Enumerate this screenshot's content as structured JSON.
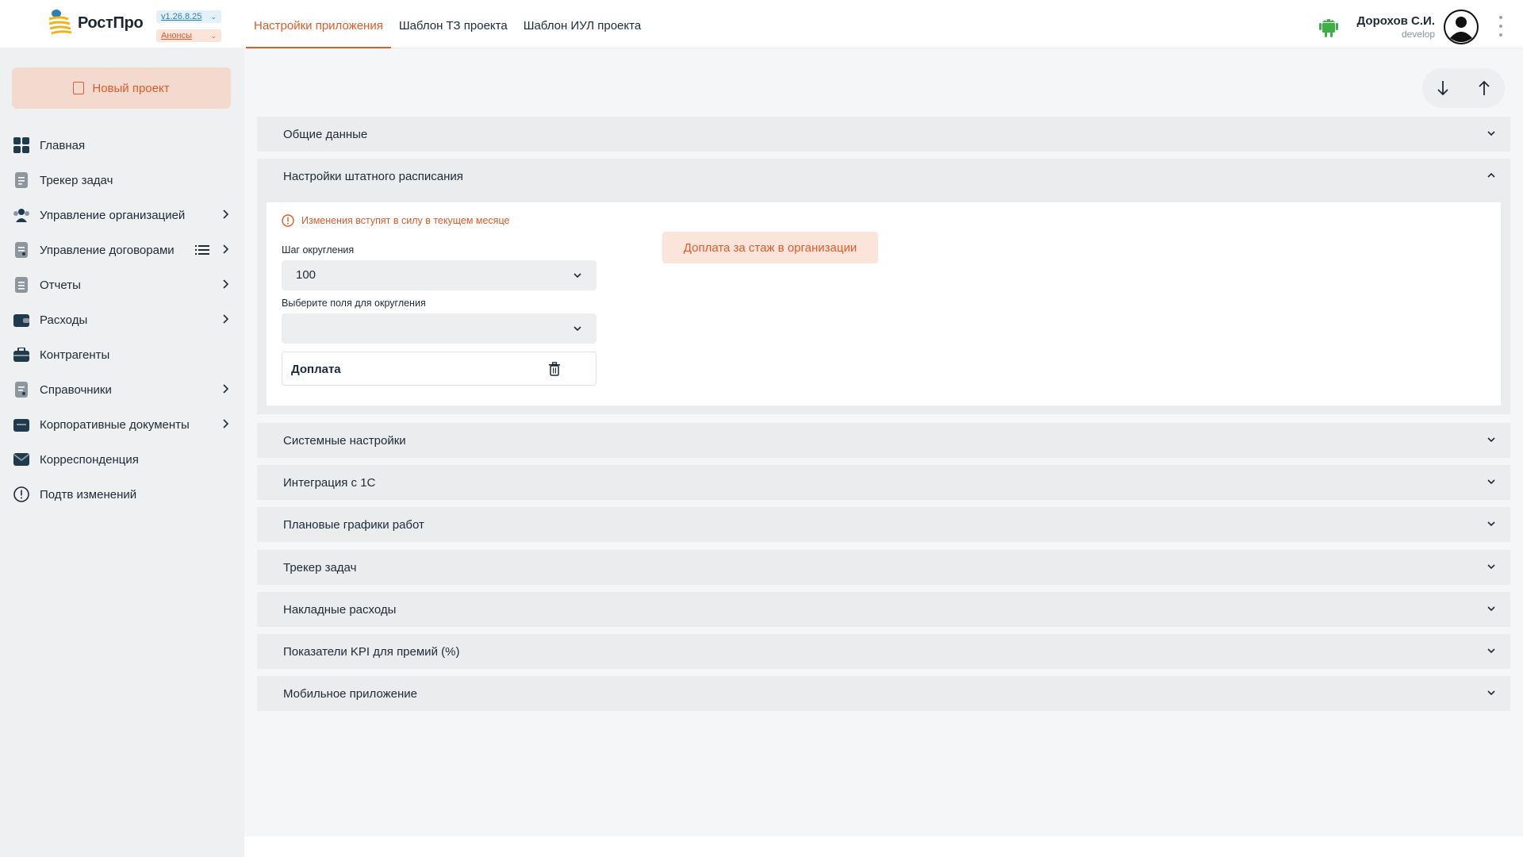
{
  "header": {
    "logo_text": "РостПро",
    "version": "v1.26.8.25",
    "announcements": "Анонсы",
    "tabs": [
      {
        "label": "Настройки приложения",
        "active": true
      },
      {
        "label": "Шаблон ТЗ проекта",
        "active": false
      },
      {
        "label": "Шаблон ИУЛ проекта",
        "active": false
      }
    ],
    "user": {
      "name": "Дорохов С.И.",
      "role": "develop"
    },
    "accent_color": "#e05a2a"
  },
  "sidebar": {
    "new_project": "Новый проект",
    "items": [
      {
        "label": "Главная",
        "icon": "grid-icon",
        "arrow": false
      },
      {
        "label": "Трекер задач",
        "icon": "document-icon",
        "arrow": false
      },
      {
        "label": "Управление организацией",
        "icon": "users-icon",
        "arrow": true
      },
      {
        "label": "Управление договорами",
        "icon": "contract-icon",
        "arrow": true,
        "list_icon": true
      },
      {
        "label": "Отчеты",
        "icon": "report-icon",
        "arrow": true
      },
      {
        "label": "Расходы",
        "icon": "wallet-icon",
        "arrow": true
      },
      {
        "label": "Контрагенты",
        "icon": "briefcase-icon",
        "arrow": false
      },
      {
        "label": "Справочники",
        "icon": "book-icon",
        "arrow": true
      },
      {
        "label": "Корпоративные документы",
        "icon": "folder-icon",
        "arrow": true
      },
      {
        "label": "Корреспонденция",
        "icon": "mail-icon",
        "arrow": false
      },
      {
        "label": "Подтв изменений",
        "icon": "alert-icon",
        "arrow": false
      }
    ]
  },
  "main": {
    "sections": [
      {
        "label": "Общие данные",
        "expanded": false
      },
      {
        "label": "Настройки штатного расписания",
        "expanded": true
      },
      {
        "label": "Системные настройки",
        "expanded": false
      },
      {
        "label": "Интеграция с 1С",
        "expanded": false
      },
      {
        "label": "Плановые графики работ",
        "expanded": false
      },
      {
        "label": "Трекер задач",
        "expanded": false
      },
      {
        "label": "Накладные расходы",
        "expanded": false
      },
      {
        "label": "Показатели KPI для премий (%)",
        "expanded": false
      },
      {
        "label": "Мобильное приложение",
        "expanded": false
      }
    ],
    "staff_settings": {
      "warning": "Изменения вступят в силу в текущем месяце",
      "rounding_step_label": "Шаг округления",
      "rounding_step_value": "100",
      "fields_label": "Выберите поля для округления",
      "fields_value": "",
      "selected_fields": [
        "Доплата"
      ],
      "bonus_button": "Доплата за стаж в организации"
    }
  }
}
